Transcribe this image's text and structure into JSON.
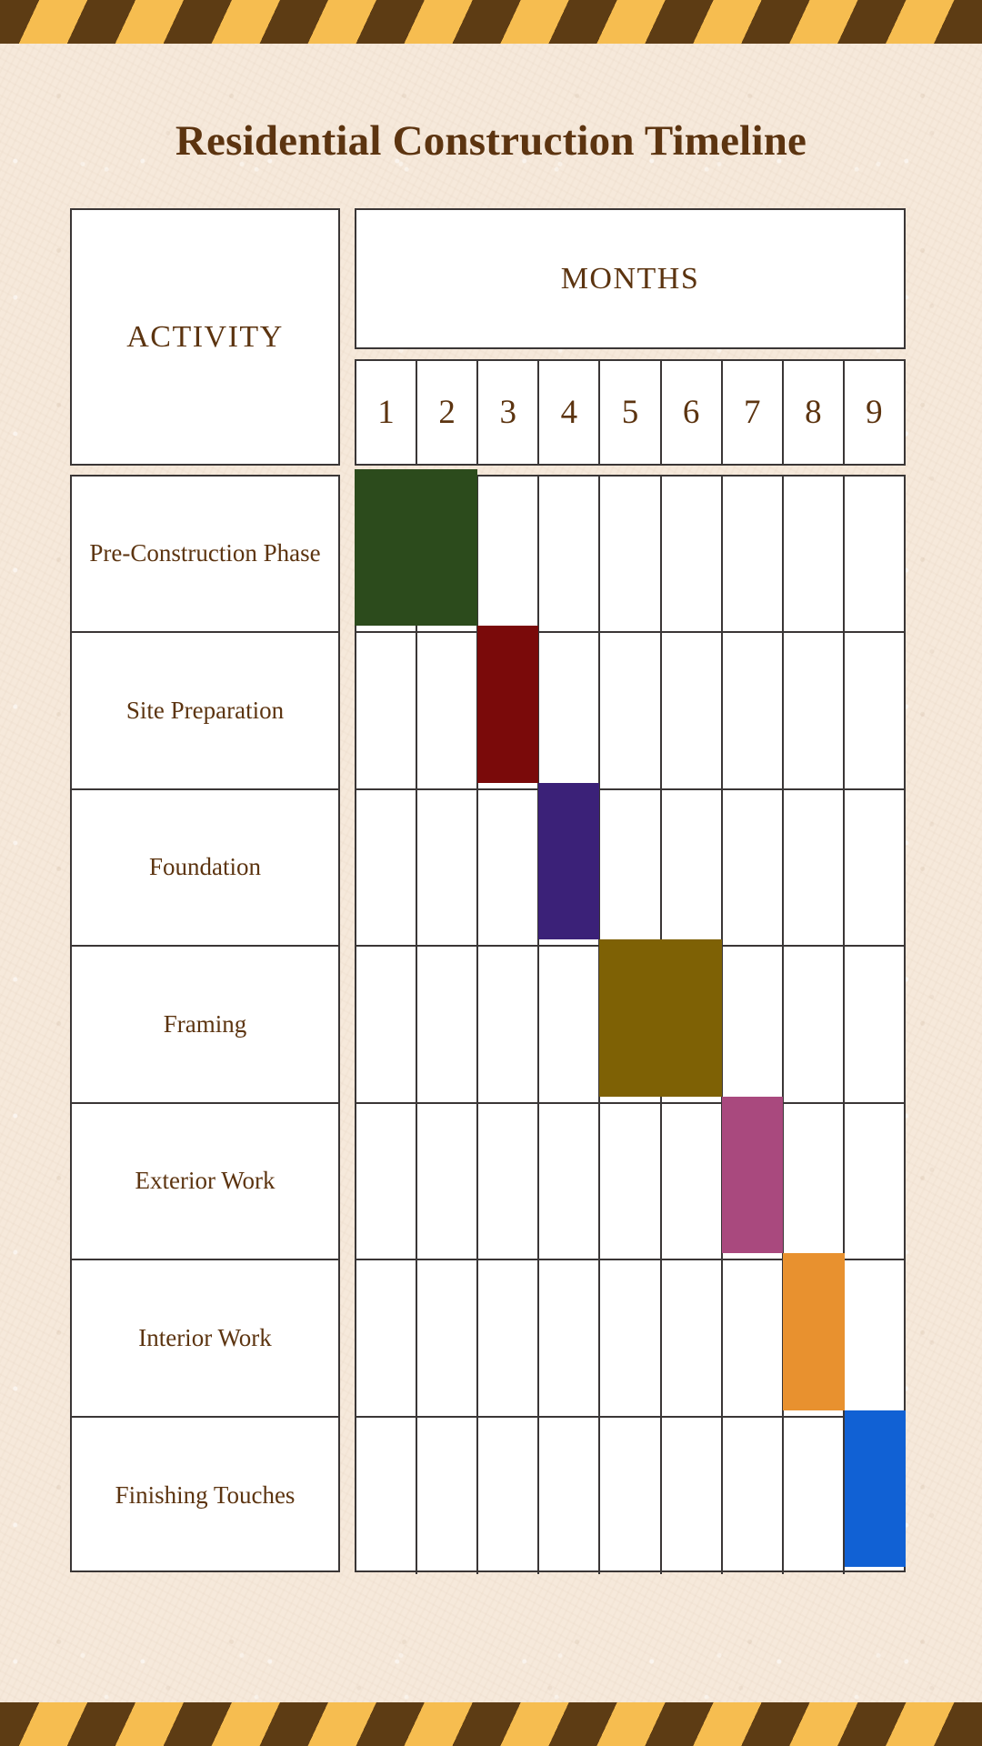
{
  "page": {
    "background_color": "#f6e9db",
    "accent_brown": "#5c3410",
    "stripe_dark": "#5d3c14",
    "stripe_yellow": "#f6bd50",
    "grid_line_color": "#3a3636"
  },
  "title": "Residential Construction Timeline",
  "table": {
    "activity_header": "ACTIVITY",
    "months_header": "MONTHS",
    "month_labels": [
      "1",
      "2",
      "3",
      "4",
      "5",
      "6",
      "7",
      "8",
      "9"
    ]
  },
  "chart_data": {
    "type": "bar",
    "title": "Residential Construction Timeline",
    "xlabel": "MONTHS",
    "ylabel": "ACTIVITY",
    "categories": [
      "1",
      "2",
      "3",
      "4",
      "5",
      "6",
      "7",
      "8",
      "9"
    ],
    "xlim": [
      1,
      9
    ],
    "grid": true,
    "legend": "none",
    "tasks": [
      {
        "name": "Pre-Construction Phase",
        "start_month": 1,
        "end_month": 2,
        "duration_months": 2,
        "color": "#2c4b1c"
      },
      {
        "name": "Site Preparation",
        "start_month": 3,
        "end_month": 3,
        "duration_months": 1,
        "color": "#7a0a0a"
      },
      {
        "name": "Foundation",
        "start_month": 4,
        "end_month": 4,
        "duration_months": 1,
        "color": "#3b2178"
      },
      {
        "name": "Framing",
        "start_month": 5,
        "end_month": 6,
        "duration_months": 2,
        "color": "#7e6105"
      },
      {
        "name": "Exterior Work",
        "start_month": 7,
        "end_month": 7,
        "duration_months": 1,
        "color": "#a9497e"
      },
      {
        "name": "Interior Work",
        "start_month": 8,
        "end_month": 8,
        "duration_months": 1,
        "color": "#e8912f"
      },
      {
        "name": "Finishing Touches",
        "start_month": 9,
        "end_month": 9,
        "duration_months": 1,
        "color": "#1161d4"
      }
    ]
  }
}
